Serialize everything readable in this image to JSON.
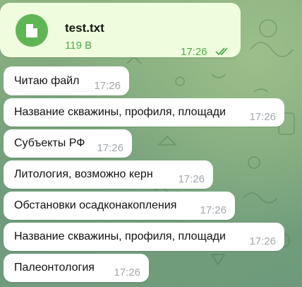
{
  "file_message": {
    "file_name": "test.txt",
    "file_size": "119 B",
    "time": "17:26",
    "icon": "file-icon",
    "read_status_icon": "double-check-icon",
    "bubble_color": "#effdde",
    "accent_color": "#60b554"
  },
  "messages": [
    {
      "text": "Читаю файл",
      "time": "17:26"
    },
    {
      "text": "Название скважины, профиля, площади",
      "time": "17:26"
    },
    {
      "text": "Субъекты РФ",
      "time": "17:26"
    },
    {
      "text": "Литология, возможно керн",
      "time": "17:26"
    },
    {
      "text": "Обстановки осадконакопления",
      "time": "17:26"
    },
    {
      "text": "Название скважины, профиля, площади",
      "time": "17:26"
    },
    {
      "text": "Палеонтология",
      "time": "17:26"
    }
  ]
}
